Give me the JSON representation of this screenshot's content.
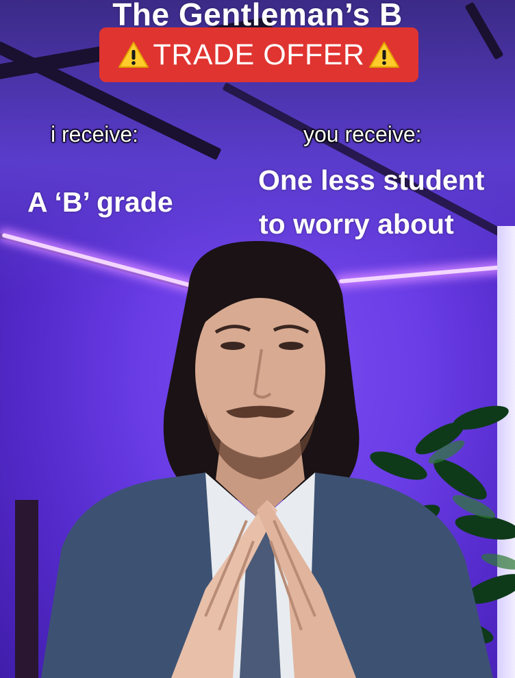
{
  "overlay": {
    "title": "The Gentleman’s B",
    "banner_text": "TRADE OFFER",
    "banner_icon": "warning-icon",
    "banner_color": "#e03431",
    "left": {
      "caption": "i receive:",
      "value": "A ‘B’ grade"
    },
    "right": {
      "caption": "you receive:",
      "value_line1": "One less student",
      "value_line2": "to worry about"
    }
  },
  "colors": {
    "wall": "#6a3de6",
    "led": "#f3d6ff",
    "suit": "#3d5273"
  }
}
